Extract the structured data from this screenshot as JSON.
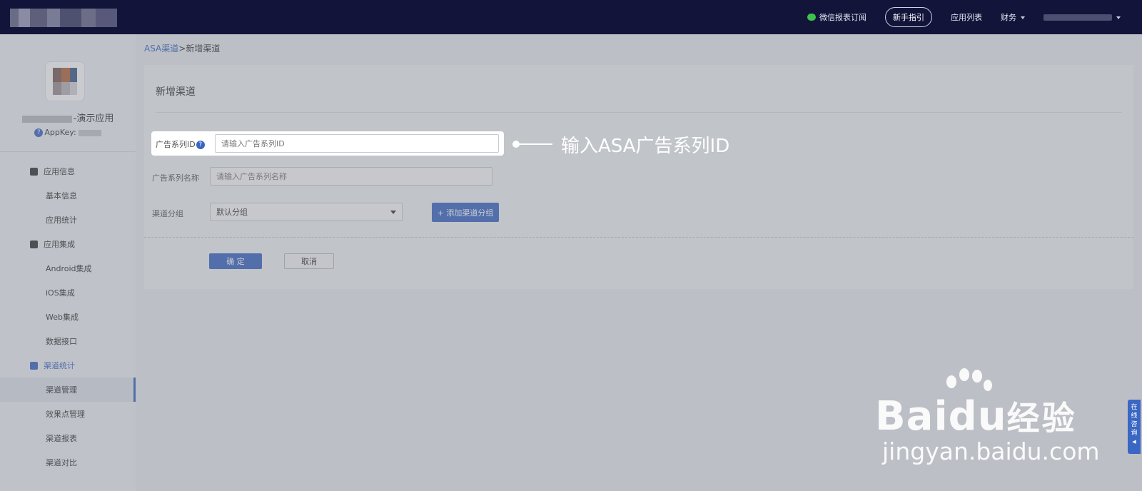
{
  "header": {
    "wechat_report": "微信报表订阅",
    "guide": "新手指引",
    "app_list": "应用列表",
    "finance": "财务"
  },
  "sidebar": {
    "app_name_suffix": "-演示应用",
    "appkey_label": "AppKey:",
    "groups": [
      {
        "label": "应用信息",
        "icon": "grid-icon",
        "items": [
          "基本信息",
          "应用统计"
        ]
      },
      {
        "label": "应用集成",
        "icon": "sdk-icon",
        "items": [
          "Android集成",
          "iOS集成",
          "Web集成",
          "数据接口"
        ]
      },
      {
        "label": "渠道统计",
        "icon": "chart-icon",
        "items": [
          "渠道管理",
          "效果点管理",
          "渠道报表",
          "渠道对比"
        ]
      }
    ],
    "active_item": "渠道管理"
  },
  "breadcrumb": {
    "parent": "ASA渠道",
    "separator": ">",
    "current": "新增渠道"
  },
  "form": {
    "title": "新增渠道",
    "campaign_id_label": "广告系列ID",
    "campaign_id_placeholder": "请输入广告系列ID",
    "campaign_name_label": "广告系列名称",
    "campaign_name_placeholder": "请输入广告系列名称",
    "group_label": "渠道分组",
    "group_value": "默认分组",
    "add_group_button": "+ 添加渠道分组",
    "confirm_button": "确 定",
    "cancel_button": "取消"
  },
  "annotation": {
    "callout": "输入ASA广告系列ID"
  },
  "consult_tab": "在线咨询",
  "watermark": {
    "brand": "Bai",
    "brand_du": "du",
    "brand_cn": "经验",
    "url": "jingyan.baidu.com"
  },
  "colors": {
    "topbar": "#12143a",
    "accent": "#3a66c4",
    "wechat_green": "#3ec24b"
  }
}
